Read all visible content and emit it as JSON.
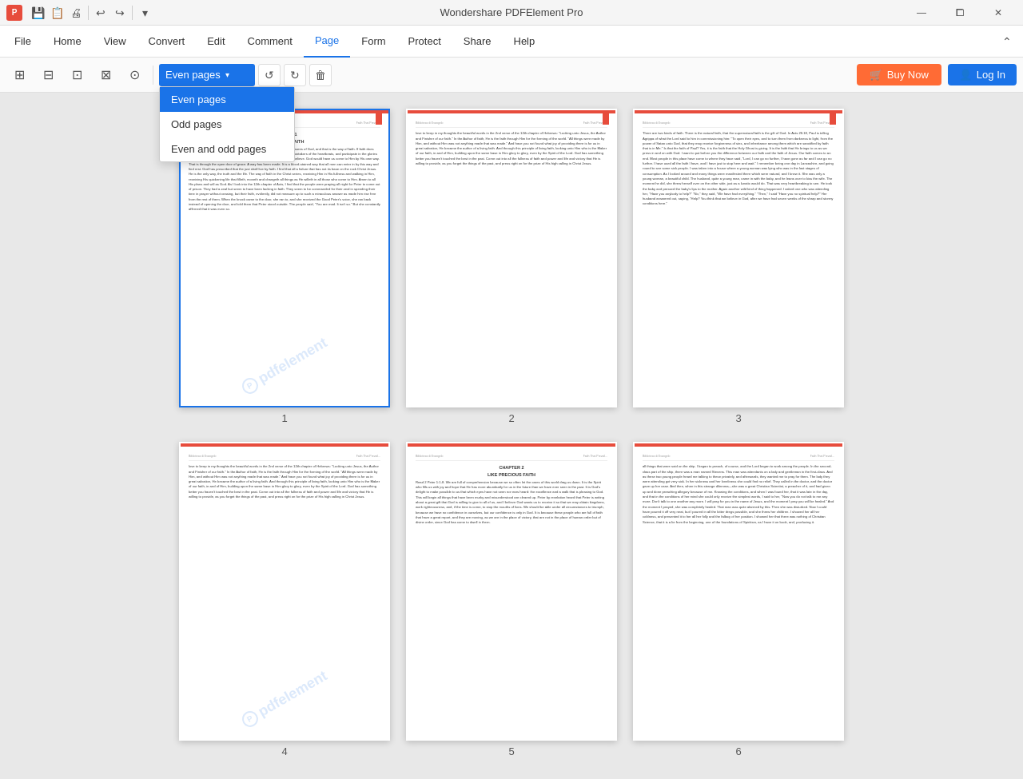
{
  "titleBar": {
    "appName": "Wondershare PDFElement Pro",
    "tools": [
      "💾",
      "📋",
      "↩",
      "↪"
    ],
    "windowControls": [
      "—",
      "⧠",
      "✕"
    ]
  },
  "menuBar": {
    "items": [
      {
        "id": "file",
        "label": "File"
      },
      {
        "id": "home",
        "label": "Home"
      },
      {
        "id": "view",
        "label": "View"
      },
      {
        "id": "convert",
        "label": "Convert"
      },
      {
        "id": "edit",
        "label": "Edit"
      },
      {
        "id": "comment",
        "label": "Comment"
      },
      {
        "id": "page",
        "label": "Page",
        "active": true
      },
      {
        "id": "form",
        "label": "Form"
      },
      {
        "id": "protect",
        "label": "Protect"
      },
      {
        "id": "share",
        "label": "Share"
      },
      {
        "id": "help",
        "label": "Help"
      }
    ]
  },
  "toolbar": {
    "buttons": [
      {
        "id": "btn1",
        "icon": "⊞",
        "title": "Insert"
      },
      {
        "id": "btn2",
        "icon": "⊟",
        "title": "Delete"
      },
      {
        "id": "btn3",
        "icon": "⊡",
        "title": "Extract"
      },
      {
        "id": "btn4",
        "icon": "⊠",
        "title": "Replace"
      },
      {
        "id": "btn5",
        "icon": "⊙",
        "title": "Split"
      }
    ],
    "pageSelectLabel": "Even pages",
    "pageSelectOptions": [
      {
        "label": "Even pages",
        "selected": true
      },
      {
        "label": "Odd pages",
        "selected": false
      },
      {
        "label": "Even and odd pages",
        "selected": false
      }
    ],
    "actionButtons": [
      {
        "id": "ccw",
        "icon": "↺",
        "title": "Rotate CCW"
      },
      {
        "id": "cw",
        "icon": "↻",
        "title": "Rotate CW"
      },
      {
        "id": "del",
        "icon": "🗑",
        "title": "Delete"
      }
    ],
    "buyNow": "Buy Now",
    "logIn": "Log In"
  },
  "content": {
    "rows": [
      {
        "pages": [
          {
            "id": "page1",
            "label": "1",
            "selected": true,
            "headerLeft": "Bibliotexa di Evangelo",
            "headerRight": "Faith That Prevail...",
            "chapterTitle": "CHAPTER 1\nGOD-GIVEN FAITH",
            "hasBookmark": true,
            "hasRedBar": true,
            "text": "Read Hebrews 11:1-6. I believe that there is only one way to all the treasures of God, and that is the way of faith. If faith does anything, it opens our eyes through a knowledge of God and becomes partakers of the heartbeats, and participate in the glories of our ascended Lord. All His promises are Yea and Amen to them that believe.\n\nGod would have us come to Him by His own way. That is through the open door of grace. A way has been made. It is a blood-stained way that all men can enter in by this way and find rest. God has prescribed that the just shall live by faith. I find that all a failure that has not its base on the rock Christ Jesus. He is the only way, the truth and the life. The way of faith in the Christ series, receiving Him in His fullness and walking in Him, receiving His quickening life that filleth, moveth and changeth all things as He willeth in all those who come to Him. Amen to all His plans and will as God.\n\nAs I look into the 12th chapter of Acts, I find that the people were praying all night for Peter to come out of prison. They had a zeal but seem to have been lacking in faith. They seem to be commanded for their zeal in spending their time in prayer without ceasing, but their faith, evidently, did not measure up to such a miraculous answer as made him rise free from the rest of them. When the knock came to the door, she ran to, and she received the Good Peter's voice, she ran back instead of opening the door, and told them that Peter stood outside. The people said, \"You are mad. It isn't so.\" But she constantly affirmed that it was even so."
          },
          {
            "id": "page2",
            "label": "2",
            "selected": false,
            "headerLeft": "Bibliotexa di Evangelo",
            "headerRight": "Faith That Prevail...",
            "chapterTitle": "",
            "hasBookmark": true,
            "hasRedBar": true,
            "text": "love to keep in my thoughts the beautiful words in the 2nd verse of the 12th chapter of Hebrews: \"Looking unto Jesus, the Author and Finisher of our faith.\" In the Author of faith, He is the faith through Him for the forming of the world. \"All things were made by Him, and without Him was not anything made that was made.\" And have you not found what joy of providing there is for us in great salvation, He became the author of a living faith. And through this principle of living faith, looking unto Him who is the Maker of our faith, in and of Him, building upon the same base in Him glory to glory, even by the Spirit of the Lord.\n\nGod has something better you haven't touched the best in the past. Come out into all the fullness of faith and power and life and victory that He is willing to provide, as you forget the things of the past, and press right on for the prize of His high calling in Christ Jesus."
          },
          {
            "id": "page3",
            "label": "3",
            "selected": false,
            "headerLeft": "Bibliotexa di Evangelo",
            "headerRight": "Faith That Prevail...",
            "chapterTitle": "",
            "hasBookmark": true,
            "hasRedBar": true,
            "text": "There are two kinds of faith. There is the natural faith, that the supernatural faith is the gift of God. In Acts 26:18, Paul is telling Agrippa of what the Lord said to him in commissioning him: \"To open their eyes, and to turn them from darkness to light, from the power of Satan unto God, that they may receive forgiveness of sins, and inheritance among them which are sanctified by faith that is in Me.\"\n\nIs that the faith of Paul? Yes, it is the faith that the Holy Ghost is giving. It is the faith that He brings to us as we press in and on with God. I want to put before you the difference between our faith and the faith of Jesus. Our faith comes to an end. Most people in this place have come to where they have said, \"Lord, I can go no further, I have gone as far and I can go no further. I have used all the faith I have, and I have just to stop here and wait.\"\n\nI remember being one day in Lancashire, and going round to see some sick people. I was taken into a house where a young woman was lying who was in the last stages of consumption. As I looked around and many things were manifested there which were natural, and I knew it. She was only a young woman, a beautiful child. The husband, quite a young man, came in with the baby, and he leans over to kiss the wife. The moment he did, she threw herself over on the other side, just as a lunatic would do. That was very heartbreaking to see. He took the baby and pressed the baby's lips to the mother. Again another wild kind of thing happened. I asked one who was attending her, \"Have you anybody to help?\" \"No,\" they said, \"We have had everything.\" \"Then,\" I said \"Have you no spiritual help?\" Her husband answered out, saying, \"Help? You think that we believe in God, after we have had seven weeks of the sharp and stormy conditions here.\""
          }
        ]
      },
      {
        "pages": [
          {
            "id": "page4",
            "label": "4",
            "selected": false,
            "headerLeft": "Bibliotexa di Evangelo",
            "headerRight": "Faith That Prevail...",
            "chapterTitle": "",
            "hasBookmark": false,
            "hasRedBar": true,
            "text": "love to keep in my thoughts the beautiful words in the 2nd verse of the 12th chapter of Hebrews: \"Looking unto Jesus, the Author and Finisher of our faith.\" In the Author of faith, He is the faith through Him for the forming of the world. \"All things were made by Him, and without Him was not anything made that was made.\" And have you not found what joy of providing there is for us in great salvation, He became the author of a living faith. And through this principle of living faith, looking unto Him who is the Maker of our faith, in and of Him, building upon the same base in Him glory to glory, even by the Spirit of the Lord.\n\nGod has something better you haven't touched the best in the past. Come out into all the fullness of faith and power and life and victory that He is willing to provide, as you forget the things of the past, and press right on for the prize of His high calling in Christ Jesus."
          },
          {
            "id": "page5",
            "label": "5",
            "selected": false,
            "headerLeft": "Bibliotexa di Evangelo",
            "headerRight": "Faith That Prevail...",
            "chapterTitle": "CHAPTER 2\nLIKE PRECIOUS FAITH",
            "hasBookmark": false,
            "hasRedBar": true,
            "text": "Read 2 Peter 1:1-8. We are full of comprehension because we so often let the cares of this world drag us down. It is the Spirit who fills us with joy and hope that He has more abundantly for us in the future than we have ever seen in the past. It is God's delight to make possible to us that which eyes have not seen nor ears heard: the excellence and a walk that is pleasing to God. This will begin all things that have been murky and misunderstood are cleared up.\n\nPeter by revelation heard that Peter is writing about a great gift that God is willing to give to all of us, and I believe God wants us to receive it so that we may obtain kingdoms, work righteousness, and, if the time is come, to stop the mouths of lions. We should be able under all circumstances to triumph, because we have no confidence in ourselves, but our confidence is only in God. It is because these people who are full of faith that have a great report, and they are moving, as we are in the place of victory, that are not in the place of human order but of divine order, since God has come to dwell in them."
          },
          {
            "id": "page6",
            "label": "6",
            "selected": false,
            "headerLeft": "Bibliotexa di Evangelo",
            "headerRight": "Faith That Prevail...",
            "chapterTitle": "",
            "hasBookmark": false,
            "hasRedBar": true,
            "text": "all things that were said on the ship. I began to preach, of course, and the Lord began to work among the people. In the second-class part of the ship, there was a man named Stevens. This man was attendants on a lady and gentleman in the first-class. And as these two young people heard me talking to these privately, and afterwards, they wanted me to pray for them. The lady they were attending got very sick. In her sickness and her loneliness she could find no relief. They called in the doctor, and the doctor gave up her case.\n\nAnd then, when in this strange dilemma—she was a great Christian Scientist, a preacher of it, and had given up and done preaching allegory because of me. Knowing the conditions, and when I was found her, that it was late in the day, and that in the conditions of her mind she could only receive the simplest words, I said to her, \"Now you do not talk to me any more. Don't talk to one another any more. I will pray for you in the name of Jesus, and the moment I pray you will be healed.\"\n\nAnd the moment I prayed, she was completely healed. That man was quite alarmed by this. Then she was disturbed. Now I could have poured it off very neat, but I poured in all the bitter dregs possible, and she threw her children. I showed her all her coldness, and presented it to her all her folly and the fallacy of her position. I showed her that there was nothing of Christian Science, that it is a lie from the beginning, one of the foundations of Spiritism, as I have it on book, and, producing it."
          }
        ]
      }
    ]
  },
  "dropdown": {
    "visible": true,
    "options": [
      "Even pages",
      "Odd pages",
      "Even and odd pages"
    ],
    "selected": "Even pages"
  }
}
